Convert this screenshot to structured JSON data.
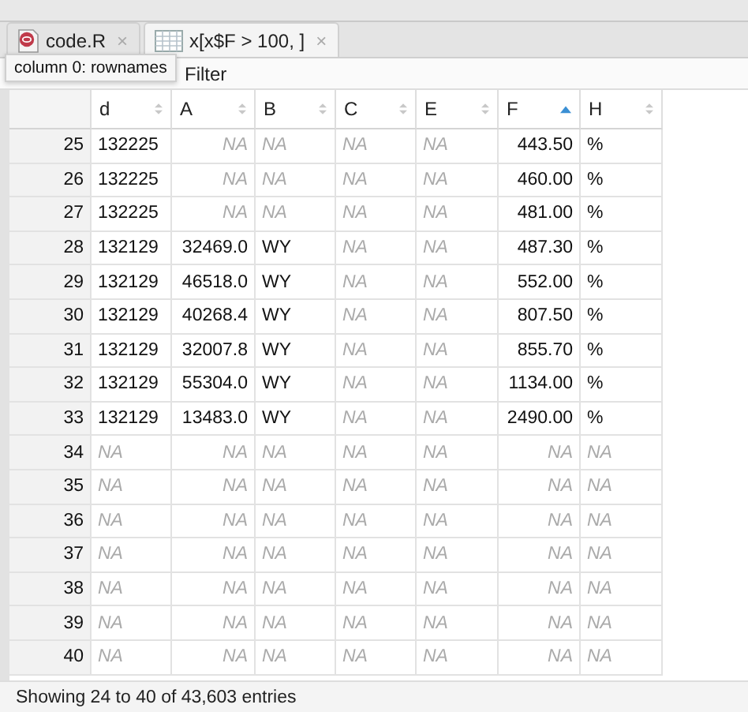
{
  "tabs": [
    {
      "label": "code.R",
      "kind": "script",
      "selected": false,
      "close": "×"
    },
    {
      "label": "x[x$F > 100, ]",
      "kind": "data",
      "selected": true,
      "close": "×"
    }
  ],
  "tooltip": "column 0: rownames",
  "toolbar": {
    "filter": "Filter"
  },
  "table": {
    "columns": [
      {
        "name": "d",
        "kind": "text",
        "sorted": false
      },
      {
        "name": "A",
        "kind": "numeric",
        "sorted": false
      },
      {
        "name": "B",
        "kind": "text",
        "sorted": false
      },
      {
        "name": "C",
        "kind": "text",
        "sorted": false
      },
      {
        "name": "E",
        "kind": "text",
        "sorted": false
      },
      {
        "name": "F",
        "kind": "numeric",
        "sorted": true
      },
      {
        "name": "H",
        "kind": "text",
        "sorted": false
      }
    ],
    "rows": [
      {
        "index": "25",
        "cells": [
          {
            "v": "132225",
            "na": false
          },
          {
            "v": "NA",
            "na": true
          },
          {
            "v": "NA",
            "na": true
          },
          {
            "v": "NA",
            "na": true
          },
          {
            "v": "NA",
            "na": true
          },
          {
            "v": "443.50",
            "na": false
          },
          {
            "v": "%",
            "na": false
          }
        ]
      },
      {
        "index": "26",
        "cells": [
          {
            "v": "132225",
            "na": false
          },
          {
            "v": "NA",
            "na": true
          },
          {
            "v": "NA",
            "na": true
          },
          {
            "v": "NA",
            "na": true
          },
          {
            "v": "NA",
            "na": true
          },
          {
            "v": "460.00",
            "na": false
          },
          {
            "v": "%",
            "na": false
          }
        ]
      },
      {
        "index": "27",
        "cells": [
          {
            "v": "132225",
            "na": false
          },
          {
            "v": "NA",
            "na": true
          },
          {
            "v": "NA",
            "na": true
          },
          {
            "v": "NA",
            "na": true
          },
          {
            "v": "NA",
            "na": true
          },
          {
            "v": "481.00",
            "na": false
          },
          {
            "v": "%",
            "na": false
          }
        ]
      },
      {
        "index": "28",
        "cells": [
          {
            "v": "132129",
            "na": false
          },
          {
            "v": "32469.0",
            "na": false
          },
          {
            "v": "WY",
            "na": false
          },
          {
            "v": "NA",
            "na": true
          },
          {
            "v": "NA",
            "na": true
          },
          {
            "v": "487.30",
            "na": false
          },
          {
            "v": "%",
            "na": false
          }
        ]
      },
      {
        "index": "29",
        "cells": [
          {
            "v": "132129",
            "na": false
          },
          {
            "v": "46518.0",
            "na": false
          },
          {
            "v": "WY",
            "na": false
          },
          {
            "v": "NA",
            "na": true
          },
          {
            "v": "NA",
            "na": true
          },
          {
            "v": "552.00",
            "na": false
          },
          {
            "v": "%",
            "na": false
          }
        ]
      },
      {
        "index": "30",
        "cells": [
          {
            "v": "132129",
            "na": false
          },
          {
            "v": "40268.4",
            "na": false
          },
          {
            "v": "WY",
            "na": false
          },
          {
            "v": "NA",
            "na": true
          },
          {
            "v": "NA",
            "na": true
          },
          {
            "v": "807.50",
            "na": false
          },
          {
            "v": "%",
            "na": false
          }
        ]
      },
      {
        "index": "31",
        "cells": [
          {
            "v": "132129",
            "na": false
          },
          {
            "v": "32007.8",
            "na": false
          },
          {
            "v": "WY",
            "na": false
          },
          {
            "v": "NA",
            "na": true
          },
          {
            "v": "NA",
            "na": true
          },
          {
            "v": "855.70",
            "na": false
          },
          {
            "v": "%",
            "na": false
          }
        ]
      },
      {
        "index": "32",
        "cells": [
          {
            "v": "132129",
            "na": false
          },
          {
            "v": "55304.0",
            "na": false
          },
          {
            "v": "WY",
            "na": false
          },
          {
            "v": "NA",
            "na": true
          },
          {
            "v": "NA",
            "na": true
          },
          {
            "v": "1134.00",
            "na": false
          },
          {
            "v": "%",
            "na": false
          }
        ]
      },
      {
        "index": "33",
        "cells": [
          {
            "v": "132129",
            "na": false
          },
          {
            "v": "13483.0",
            "na": false
          },
          {
            "v": "WY",
            "na": false
          },
          {
            "v": "NA",
            "na": true
          },
          {
            "v": "NA",
            "na": true
          },
          {
            "v": "2490.00",
            "na": false
          },
          {
            "v": "%",
            "na": false
          }
        ]
      },
      {
        "index": "34",
        "cells": [
          {
            "v": "NA",
            "na": true
          },
          {
            "v": "NA",
            "na": true
          },
          {
            "v": "NA",
            "na": true
          },
          {
            "v": "NA",
            "na": true
          },
          {
            "v": "NA",
            "na": true
          },
          {
            "v": "NA",
            "na": true
          },
          {
            "v": "NA",
            "na": true
          }
        ]
      },
      {
        "index": "35",
        "cells": [
          {
            "v": "NA",
            "na": true
          },
          {
            "v": "NA",
            "na": true
          },
          {
            "v": "NA",
            "na": true
          },
          {
            "v": "NA",
            "na": true
          },
          {
            "v": "NA",
            "na": true
          },
          {
            "v": "NA",
            "na": true
          },
          {
            "v": "NA",
            "na": true
          }
        ]
      },
      {
        "index": "36",
        "cells": [
          {
            "v": "NA",
            "na": true
          },
          {
            "v": "NA",
            "na": true
          },
          {
            "v": "NA",
            "na": true
          },
          {
            "v": "NA",
            "na": true
          },
          {
            "v": "NA",
            "na": true
          },
          {
            "v": "NA",
            "na": true
          },
          {
            "v": "NA",
            "na": true
          }
        ]
      },
      {
        "index": "37",
        "cells": [
          {
            "v": "NA",
            "na": true
          },
          {
            "v": "NA",
            "na": true
          },
          {
            "v": "NA",
            "na": true
          },
          {
            "v": "NA",
            "na": true
          },
          {
            "v": "NA",
            "na": true
          },
          {
            "v": "NA",
            "na": true
          },
          {
            "v": "NA",
            "na": true
          }
        ]
      },
      {
        "index": "38",
        "cells": [
          {
            "v": "NA",
            "na": true
          },
          {
            "v": "NA",
            "na": true
          },
          {
            "v": "NA",
            "na": true
          },
          {
            "v": "NA",
            "na": true
          },
          {
            "v": "NA",
            "na": true
          },
          {
            "v": "NA",
            "na": true
          },
          {
            "v": "NA",
            "na": true
          }
        ]
      },
      {
        "index": "39",
        "cells": [
          {
            "v": "NA",
            "na": true
          },
          {
            "v": "NA",
            "na": true
          },
          {
            "v": "NA",
            "na": true
          },
          {
            "v": "NA",
            "na": true
          },
          {
            "v": "NA",
            "na": true
          },
          {
            "v": "NA",
            "na": true
          },
          {
            "v": "NA",
            "na": true
          }
        ]
      },
      {
        "index": "40",
        "cells": [
          {
            "v": "NA",
            "na": true
          },
          {
            "v": "NA",
            "na": true
          },
          {
            "v": "NA",
            "na": true
          },
          {
            "v": "NA",
            "na": true
          },
          {
            "v": "NA",
            "na": true
          },
          {
            "v": "NA",
            "na": true
          },
          {
            "v": "NA",
            "na": true
          }
        ]
      }
    ]
  },
  "status_bar": "Showing 24 to 40 of 43,603 entries"
}
